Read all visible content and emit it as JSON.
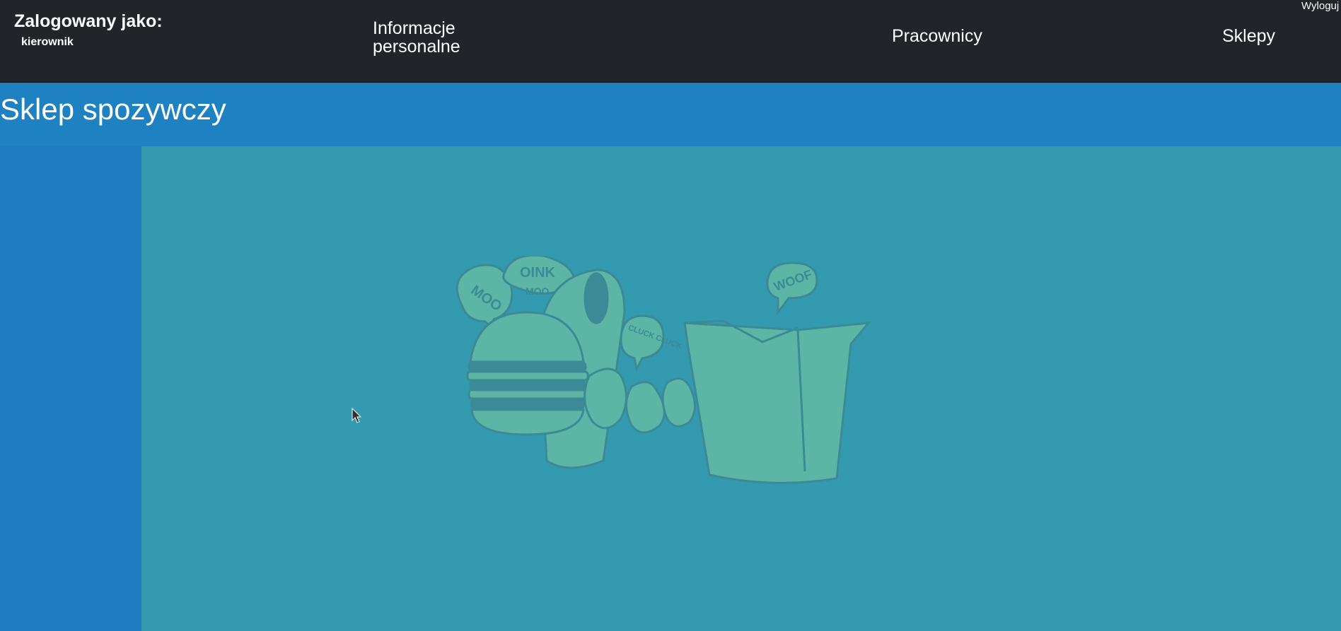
{
  "header": {
    "logged_in_label": "Zalogowany jako:",
    "username": "kierownik",
    "nav": {
      "personal_info": "Informacje personalne",
      "employees": "Pracownicy",
      "shops": "Sklepy"
    },
    "logout": "Wyloguj"
  },
  "main": {
    "title": "Sklep spozywczy",
    "illustration_text": {
      "moo": "MOO",
      "oink": "OINK",
      "moo2": "MOO",
      "cluck": "CLUCK CLUCK",
      "woof": "WOOF"
    }
  },
  "colors": {
    "navbar": "#212529",
    "title_band": "#1e81c2",
    "content_bg": "#349ab0",
    "illustration": "#5db5a5",
    "illustration_line": "#3b8a96"
  }
}
